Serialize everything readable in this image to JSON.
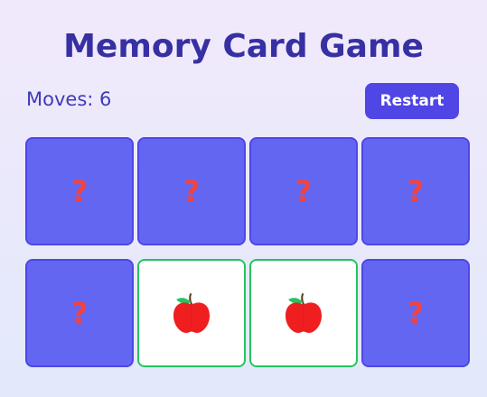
{
  "title": "Memory Card Game",
  "moves_text": "Moves: 6",
  "restart_label": "Restart",
  "hidden_symbol": "?",
  "cards": [
    {
      "state": "hidden"
    },
    {
      "state": "hidden"
    },
    {
      "state": "hidden"
    },
    {
      "state": "hidden"
    },
    {
      "state": "hidden"
    },
    {
      "state": "matched",
      "icon": "apple-icon"
    },
    {
      "state": "matched",
      "icon": "apple-icon"
    },
    {
      "state": "hidden"
    }
  ],
  "colors": {
    "title": "#3730a3",
    "button": "#4f46e5",
    "card_back": "#6366f1",
    "question_mark": "#ef4444",
    "matched_border": "#22c55e"
  }
}
